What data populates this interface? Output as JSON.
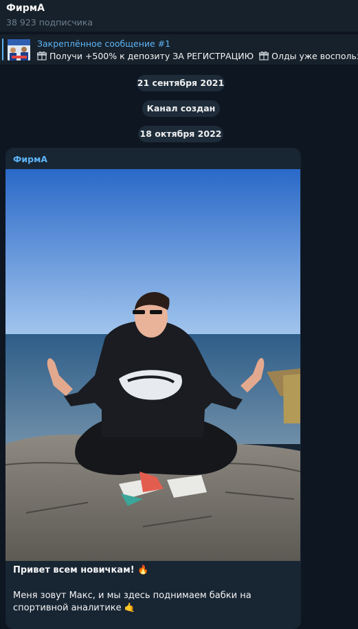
{
  "channel": {
    "name": "ФирмА",
    "subscribers": "38 923 подписчика"
  },
  "pinned": {
    "title": "Закреплённое сообщение #1",
    "text": "Получи +500% к депозиту ЗА РЕГИСТРАЦИЮ",
    "text_continued": "Олды уже воспользов"
  },
  "dates": {
    "date1": "21 сентября 2021",
    "service": "Канал создан",
    "date2": "18 октября 2022"
  },
  "message": {
    "sender": "ФирмА",
    "title": "Привет всем новичкам!",
    "title_emoji": "🔥",
    "body": "Меня зовут Макс, и мы здесь поднимаем бабки на спортивной аналитике",
    "body_emoji": "🤙"
  },
  "colors": {
    "background": "#0e1621",
    "panel": "#17212b",
    "accent": "#5eb5f7",
    "bubble": "#182533"
  },
  "icons": {
    "pin_thumbnail": "promo-thumbnail",
    "gift": "gift-icon"
  }
}
